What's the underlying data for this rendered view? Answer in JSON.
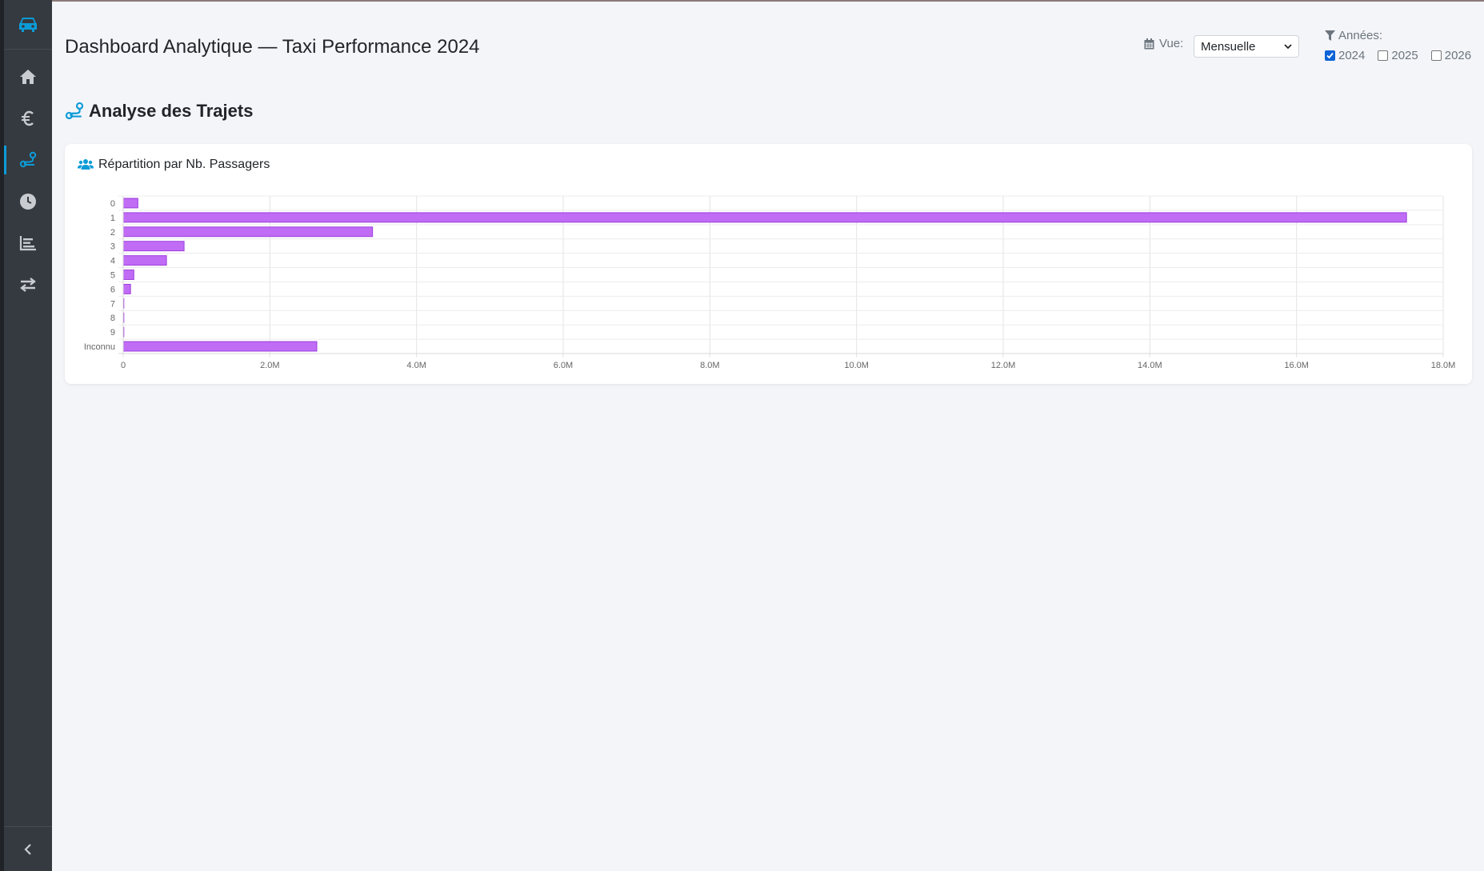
{
  "page": {
    "title": "Dashboard Analytique — Taxi Performance 2024",
    "view_label": "Vue:",
    "view_value": "Mensuelle",
    "years_label": "Années:",
    "years": [
      {
        "label": "2024",
        "checked": true
      },
      {
        "label": "2025",
        "checked": false
      },
      {
        "label": "2026",
        "checked": false
      }
    ]
  },
  "sidebar": {
    "items": [
      {
        "icon": "home-icon",
        "active": false
      },
      {
        "icon": "euro-icon",
        "active": false
      },
      {
        "icon": "route-icon",
        "active": true
      },
      {
        "icon": "clock-icon",
        "active": false
      },
      {
        "icon": "bar-chart-icon",
        "active": false
      },
      {
        "icon": "exchange-icon",
        "active": false
      }
    ]
  },
  "section": {
    "title": "Analyse des Trajets",
    "card_title": "Répartition par Nb. Passagers"
  },
  "colors": {
    "accent": "#0d9bd8",
    "bar_fill": "#c06cf5",
    "bar_stroke": "#9d3ee0",
    "sidebar": "#343a40"
  },
  "chart_data": {
    "type": "bar",
    "orientation": "horizontal",
    "categories": [
      "0",
      "1",
      "2",
      "3",
      "4",
      "5",
      "6",
      "7",
      "8",
      "9",
      "Inconnu"
    ],
    "values": [
      200000,
      17500000,
      3400000,
      830000,
      590000,
      145000,
      100000,
      4000,
      2000,
      1000,
      2640000
    ],
    "xlim": [
      0,
      18000000
    ],
    "xticks": [
      "0",
      "2.0M",
      "4.0M",
      "6.0M",
      "8.0M",
      "10.0M",
      "12.0M",
      "14.0M",
      "16.0M",
      "18.0M"
    ],
    "grid": true
  }
}
